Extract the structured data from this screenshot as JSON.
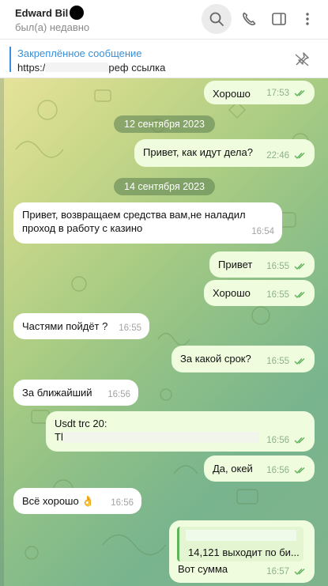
{
  "header": {
    "name": "Edward Bil",
    "status": "был(а) недавно"
  },
  "pinned": {
    "title": "Закреплённое сообщение",
    "text_prefix": "https:/",
    "text_suffix": "реф ссылка"
  },
  "messages": [
    {
      "text": "Хорошо",
      "time": "17:53",
      "dir": "out"
    },
    {
      "date": "12 сентября 2023"
    },
    {
      "text": "Привет, как идут дела?",
      "time": "22:46",
      "dir": "out"
    },
    {
      "date": "14 сентября 2023"
    },
    {
      "text_line1": "Привет, возвращаем средства вам,не наладил",
      "text_line2": "проход в работу с казино",
      "time": "16:54",
      "dir": "in"
    },
    {
      "text": "Привет",
      "time": "16:55",
      "dir": "out"
    },
    {
      "text": "Хорошо",
      "time": "16:55",
      "dir": "out"
    },
    {
      "text": "Частями пойдёт ?",
      "time": "16:55",
      "dir": "in"
    },
    {
      "text": "За какой срок?",
      "time": "16:55",
      "dir": "out"
    },
    {
      "text": "За ближайший",
      "time": "16:56",
      "dir": "in"
    },
    {
      "text_line1": "Usdt trc 20:",
      "text_line2": "Tl",
      "time": "16:56",
      "dir": "out"
    },
    {
      "text": "Да, окей",
      "time": "16:56",
      "dir": "out"
    },
    {
      "text": "Всё хорошо 👌",
      "time": "16:56",
      "dir": "in"
    },
    {
      "reply_text": "14,121 выходит по би...",
      "text": "Вот сумма",
      "time": "16:57",
      "dir": "out"
    }
  ],
  "colors": {
    "accent": "#3a8fd8",
    "outgoing_bubble": "#effdde",
    "incoming_bubble": "#ffffff",
    "check_green": "#5fb35a"
  },
  "icons": [
    "search-icon",
    "phone-icon",
    "sidebar-panel-icon",
    "more-vertical-icon",
    "unpin-icon",
    "double-check-icon"
  ]
}
